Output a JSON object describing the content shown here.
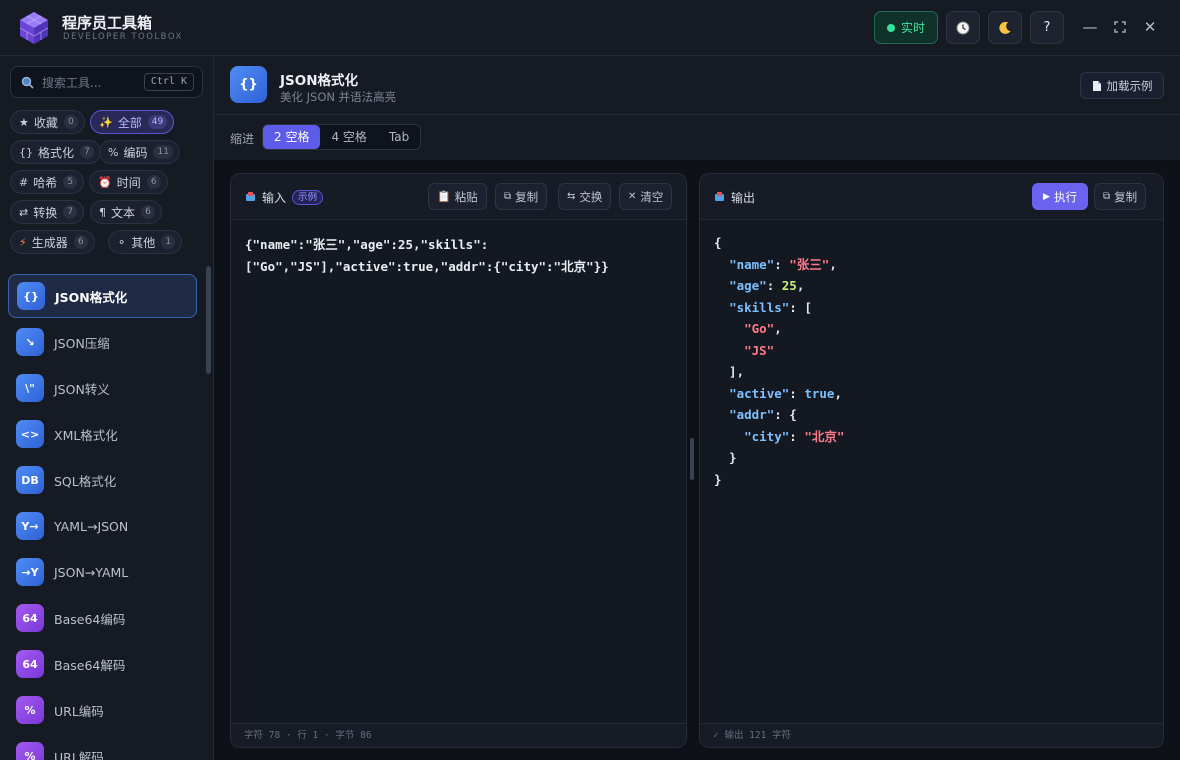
{
  "app": {
    "title": "程序员工具箱",
    "subtitle": "DEVELOPER TOOLBOX",
    "live_label": "实时",
    "history_icon": "clock-icon",
    "theme_icon": "moon-icon",
    "help_label": "?",
    "minimize": "—",
    "maximize": "⛶",
    "close": "✕"
  },
  "sidebar": {
    "search_placeholder": "搜索工具...",
    "shortcut": "Ctrl K",
    "categories": [
      {
        "icon": "★",
        "label": "收藏",
        "count": "0"
      },
      {
        "icon": "✨",
        "label": "全部",
        "count": "49"
      },
      {
        "icon": "{}",
        "label": "格式化",
        "count": "7"
      },
      {
        "icon": "%",
        "label": "编码",
        "count": "11"
      },
      {
        "icon": "#",
        "label": "哈希",
        "count": "5"
      },
      {
        "icon": "⏰",
        "label": "时间",
        "count": "6"
      },
      {
        "icon": "⇄",
        "label": "转换",
        "count": "7"
      },
      {
        "icon": "¶",
        "label": "文本",
        "count": "6"
      },
      {
        "icon": "⚡",
        "label": "生成器",
        "count": "6"
      },
      {
        "icon": "⚬",
        "label": "其他",
        "count": "1"
      }
    ],
    "tools": [
      {
        "icon": "{}",
        "label": "JSON格式化",
        "color": "blue"
      },
      {
        "icon": "↘",
        "label": "JSON压缩",
        "color": "blue"
      },
      {
        "icon": "\\\"",
        "label": "JSON转义",
        "color": "blue"
      },
      {
        "icon": "<>",
        "label": "XML格式化",
        "color": "blue"
      },
      {
        "icon": "DB",
        "label": "SQL格式化",
        "color": "blue"
      },
      {
        "icon": "Y→",
        "label": "YAML→JSON",
        "color": "blue"
      },
      {
        "icon": "→Y",
        "label": "JSON→YAML",
        "color": "blue"
      },
      {
        "icon": "64",
        "label": "Base64编码",
        "color": "purple"
      },
      {
        "icon": "64",
        "label": "Base64解码",
        "color": "purple"
      },
      {
        "icon": "%",
        "label": "URL编码",
        "color": "purple"
      },
      {
        "icon": "%",
        "label": "URL解码",
        "color": "purple"
      }
    ]
  },
  "tool": {
    "icon": "{}",
    "title": "JSON格式化",
    "description": "美化 JSON 并语法高亮",
    "load_example": "加载示例",
    "indent_label": "缩进",
    "indent_options": [
      "2 空格",
      "4 空格",
      "Tab"
    ],
    "indent_selected": "2 空格"
  },
  "input_panel": {
    "title": "输入",
    "badge": "示例",
    "buttons": {
      "paste": "粘贴",
      "copy": "复制",
      "swap": "交换",
      "clear": "清空"
    },
    "content_line1": "{\"name\":\"张三\",\"age\":25,\"skills\":",
    "content_line2": "[\"Go\",\"JS\"],\"active\":true,\"addr\":{\"city\":\"北京\"}}",
    "footer": "字符 78 · 行 1 · 字节 86"
  },
  "output_panel": {
    "title": "输出",
    "run": "执行",
    "copy": "复制",
    "lines": [
      [
        {
          "t": "{",
          "c": "p"
        }
      ],
      [
        {
          "t": "  ",
          "c": "p"
        },
        {
          "t": "\"name\"",
          "c": "k"
        },
        {
          "t": ": ",
          "c": "p"
        },
        {
          "t": "\"张三\"",
          "c": "s"
        },
        {
          "t": ",",
          "c": "p"
        }
      ],
      [
        {
          "t": "  ",
          "c": "p"
        },
        {
          "t": "\"age\"",
          "c": "k"
        },
        {
          "t": ": ",
          "c": "p"
        },
        {
          "t": "25",
          "c": "n"
        },
        {
          "t": ",",
          "c": "p"
        }
      ],
      [
        {
          "t": "  ",
          "c": "p"
        },
        {
          "t": "\"skills\"",
          "c": "k"
        },
        {
          "t": ": [",
          "c": "p"
        }
      ],
      [
        {
          "t": "    ",
          "c": "p"
        },
        {
          "t": "\"Go\"",
          "c": "s"
        },
        {
          "t": ",",
          "c": "p"
        }
      ],
      [
        {
          "t": "    ",
          "c": "p"
        },
        {
          "t": "\"JS\"",
          "c": "s"
        }
      ],
      [
        {
          "t": "  ],",
          "c": "p"
        }
      ],
      [
        {
          "t": "  ",
          "c": "p"
        },
        {
          "t": "\"active\"",
          "c": "k"
        },
        {
          "t": ": ",
          "c": "p"
        },
        {
          "t": "true",
          "c": "b"
        },
        {
          "t": ",",
          "c": "p"
        }
      ],
      [
        {
          "t": "  ",
          "c": "p"
        },
        {
          "t": "\"addr\"",
          "c": "k"
        },
        {
          "t": ": {",
          "c": "p"
        }
      ],
      [
        {
          "t": "    ",
          "c": "p"
        },
        {
          "t": "\"city\"",
          "c": "k"
        },
        {
          "t": ": ",
          "c": "p"
        },
        {
          "t": "\"北京\"",
          "c": "s"
        }
      ],
      [
        {
          "t": "  }",
          "c": "p"
        }
      ],
      [
        {
          "t": "}",
          "c": "p"
        }
      ]
    ],
    "footer": "✓ 输出 121 字符"
  },
  "colors": {
    "accent": "#5d5be8",
    "live": "#3ee09a",
    "json_key": "#7cc0ff",
    "json_string": "#ff7b8a",
    "json_number": "#c7f07a"
  }
}
